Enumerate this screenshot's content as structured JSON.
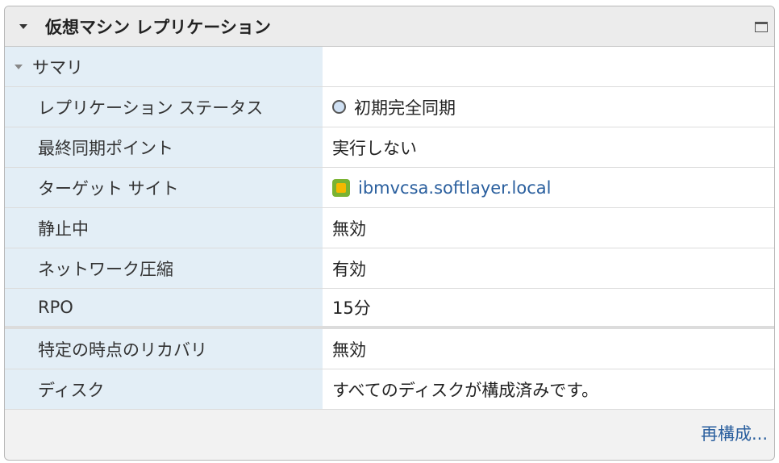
{
  "header": {
    "title": "仮想マシン レプリケーション"
  },
  "summary": {
    "label": "サマリ"
  },
  "rows": [
    {
      "label": "レプリケーション ステータス",
      "value": "初期完全同期",
      "icon": "clock-icon"
    },
    {
      "label": "最終同期ポイント",
      "value": "実行しない"
    },
    {
      "label": "ターゲット サイト",
      "value": "ibmvcsa.softlayer.local",
      "icon": "vcenter-icon"
    },
    {
      "label": "静止中",
      "value": "無効"
    },
    {
      "label": "ネットワーク圧縮",
      "value": "有効"
    },
    {
      "label": "RPO",
      "value": "15分"
    },
    {
      "label": "特定の時点のリカバリ",
      "value": "無効"
    },
    {
      "label": "ディスク",
      "value": "すべてのディスクが構成済みです。"
    }
  ],
  "footer": {
    "reconfigure": "再構成..."
  }
}
